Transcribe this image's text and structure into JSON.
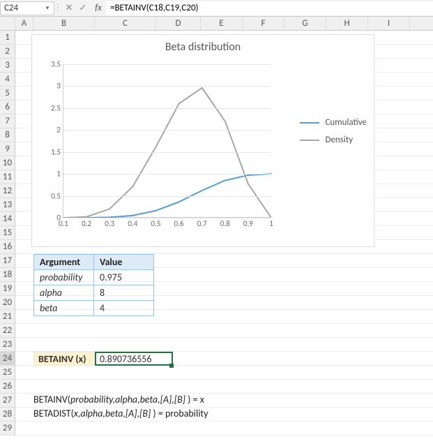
{
  "formula_bar": {
    "cell_ref": "C24",
    "formula": "=BETAINV(C18,C19,C20)"
  },
  "columns": [
    "A",
    "B",
    "C",
    "D",
    "E",
    "F",
    "G",
    "H",
    "I"
  ],
  "row_count": 29,
  "active_row": 24,
  "chart": {
    "title": "Beta distribution",
    "legend": [
      {
        "label": "Cumulative",
        "color": "#5b9bd5"
      },
      {
        "label": "Density",
        "color": "#a6a6a6"
      }
    ]
  },
  "chart_data": {
    "type": "line",
    "title": "Beta distribution",
    "xlabel": "",
    "ylabel": "",
    "xlim": [
      0.1,
      1.0
    ],
    "ylim": [
      0,
      3.5
    ],
    "x": [
      0.1,
      0.2,
      0.3,
      0.4,
      0.5,
      0.6,
      0.7,
      0.8,
      0.9,
      1.0
    ],
    "x_ticks": [
      "0.1",
      "0.2",
      "0.3",
      "0.4",
      "0.5",
      "0.6",
      "0.7",
      "0.8",
      "0.9",
      "1"
    ],
    "y_ticks": [
      "0",
      "0.5",
      "1",
      "1.5",
      "2",
      "2.5",
      "3",
      "3.5"
    ],
    "series": [
      {
        "name": "Cumulative",
        "color": "#5b9bd5",
        "values": [
          0.0,
          0.0,
          0.01,
          0.05,
          0.16,
          0.36,
          0.62,
          0.85,
          0.97,
          1.0
        ]
      },
      {
        "name": "Density",
        "color": "#a6a6a6",
        "values": [
          0.0,
          0.02,
          0.2,
          0.71,
          1.61,
          2.6,
          2.96,
          2.2,
          0.77,
          0.0
        ]
      }
    ]
  },
  "args_table": {
    "headers": {
      "arg": "Argument",
      "val": "Value"
    },
    "rows": [
      {
        "arg": "probability",
        "val": "0.975"
      },
      {
        "arg": "alpha",
        "val": "8"
      },
      {
        "arg": "beta",
        "val": "4"
      }
    ]
  },
  "result": {
    "label": "BETAINV (x)",
    "value": "0.890736556"
  },
  "signatures": {
    "line1": {
      "fn": "BETAINV(",
      "args": "probability,alpha,beta,[A],[B]",
      "tail": " ) = x"
    },
    "line2": {
      "fn": "BETADIST(",
      "args": "x,alpha,beta,[A],[B]",
      "tail": " ) = probability"
    }
  }
}
